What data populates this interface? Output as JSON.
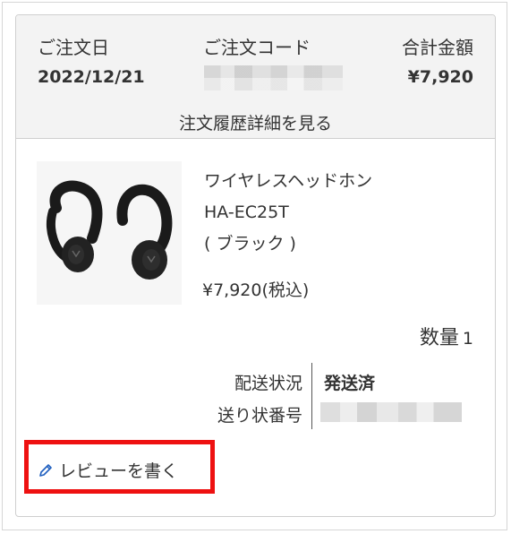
{
  "order": {
    "date_label": "ご注文日",
    "date_value": "2022/12/21",
    "code_label": "ご注文コード",
    "total_label": "合計金額",
    "total_value": "¥7,920",
    "detail_link": "注文履歴詳細を見る"
  },
  "item": {
    "name_line1": "ワイヤレスヘッドホン",
    "name_line2": "HA-EC25T",
    "name_line3": "( ブラック )",
    "price": "¥7,920",
    "tax_note": "(税込)",
    "quantity_label": "数量",
    "quantity_value": "1",
    "image_icon": "earbuds-product-image"
  },
  "shipping": {
    "status_label": "配送状況",
    "status_value": "発送済",
    "tracking_label": "送り状番号"
  },
  "actions": {
    "review_label": "レビューを書く",
    "review_icon": "pencil-icon",
    "highlight_color": "#ee1111"
  }
}
